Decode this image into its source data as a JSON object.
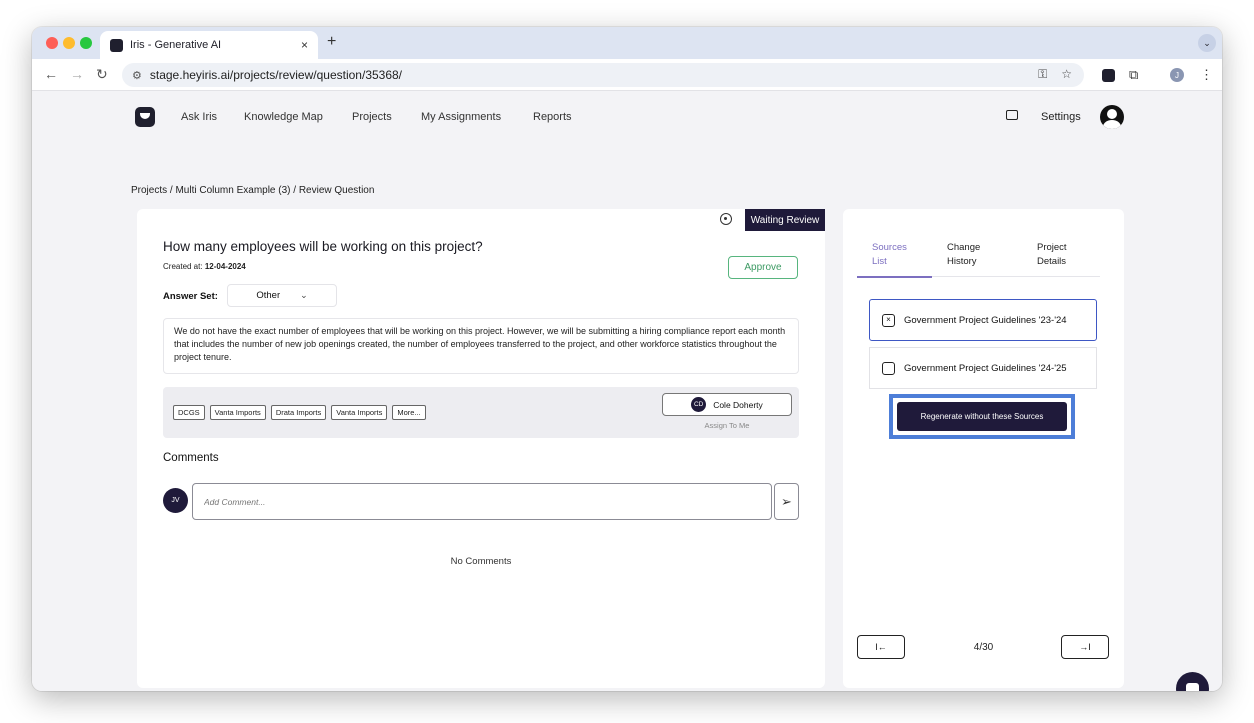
{
  "browser": {
    "tab_title": "Iris - Generative AI",
    "tab_close": "×",
    "new_tab": "+",
    "url": "stage.heyiris.ai/projects/review/question/35368/",
    "profile_initial": "J"
  },
  "nav": {
    "links": [
      "Ask Iris",
      "Knowledge Map",
      "Projects",
      "My Assignments",
      "Reports"
    ],
    "settings": "Settings"
  },
  "breadcrumb": "Projects / Multi Column Example (3) / Review Question",
  "question": {
    "status": "Waiting Review",
    "title": "How many employees will be working on this project?",
    "created_label": "Created at:",
    "created_date": "12-04-2024",
    "approve_label": "Approve",
    "answer_set_label": "Answer Set:",
    "answer_set_value": "Other",
    "answer_text": "We do not have the exact number of employees that will be working on this project. However, we will be submitting a hiring compliance report each month that includes the number of new job openings created, the number of employees transferred to the project, and other workforce statistics throughout the project tenure.",
    "tags": [
      "DCGS",
      "Vanta Imports",
      "Drata Imports",
      "Vanta Imports",
      "More..."
    ],
    "assignee_initials": "CD",
    "assignee_name": "Cole Doherty",
    "assign_to_me": "Assign To Me"
  },
  "comments": {
    "title": "Comments",
    "user_initials": "JV",
    "placeholder": "Add Comment...",
    "empty_text": "No Comments"
  },
  "sidebar": {
    "tabs": [
      {
        "line1": "Sources",
        "line2": "List"
      },
      {
        "line1": "Change",
        "line2": "History"
      },
      {
        "line1": "Project",
        "line2": "Details"
      }
    ],
    "sources": [
      {
        "label": "Government Project Guidelines '23-'24",
        "mark": "×"
      },
      {
        "label": "Government Project Guidelines '24-'25",
        "mark": ""
      }
    ],
    "regenerate_label": "Regenerate without these Sources",
    "first_icon": "I←",
    "last_icon": "→I",
    "page_counter": "4/30"
  },
  "colors": {
    "brand_dark": "#1f1a3a",
    "accent_purple": "#7c6fc0",
    "approve_green": "#3c9a63",
    "highlight_blue": "#4d7ed8"
  }
}
